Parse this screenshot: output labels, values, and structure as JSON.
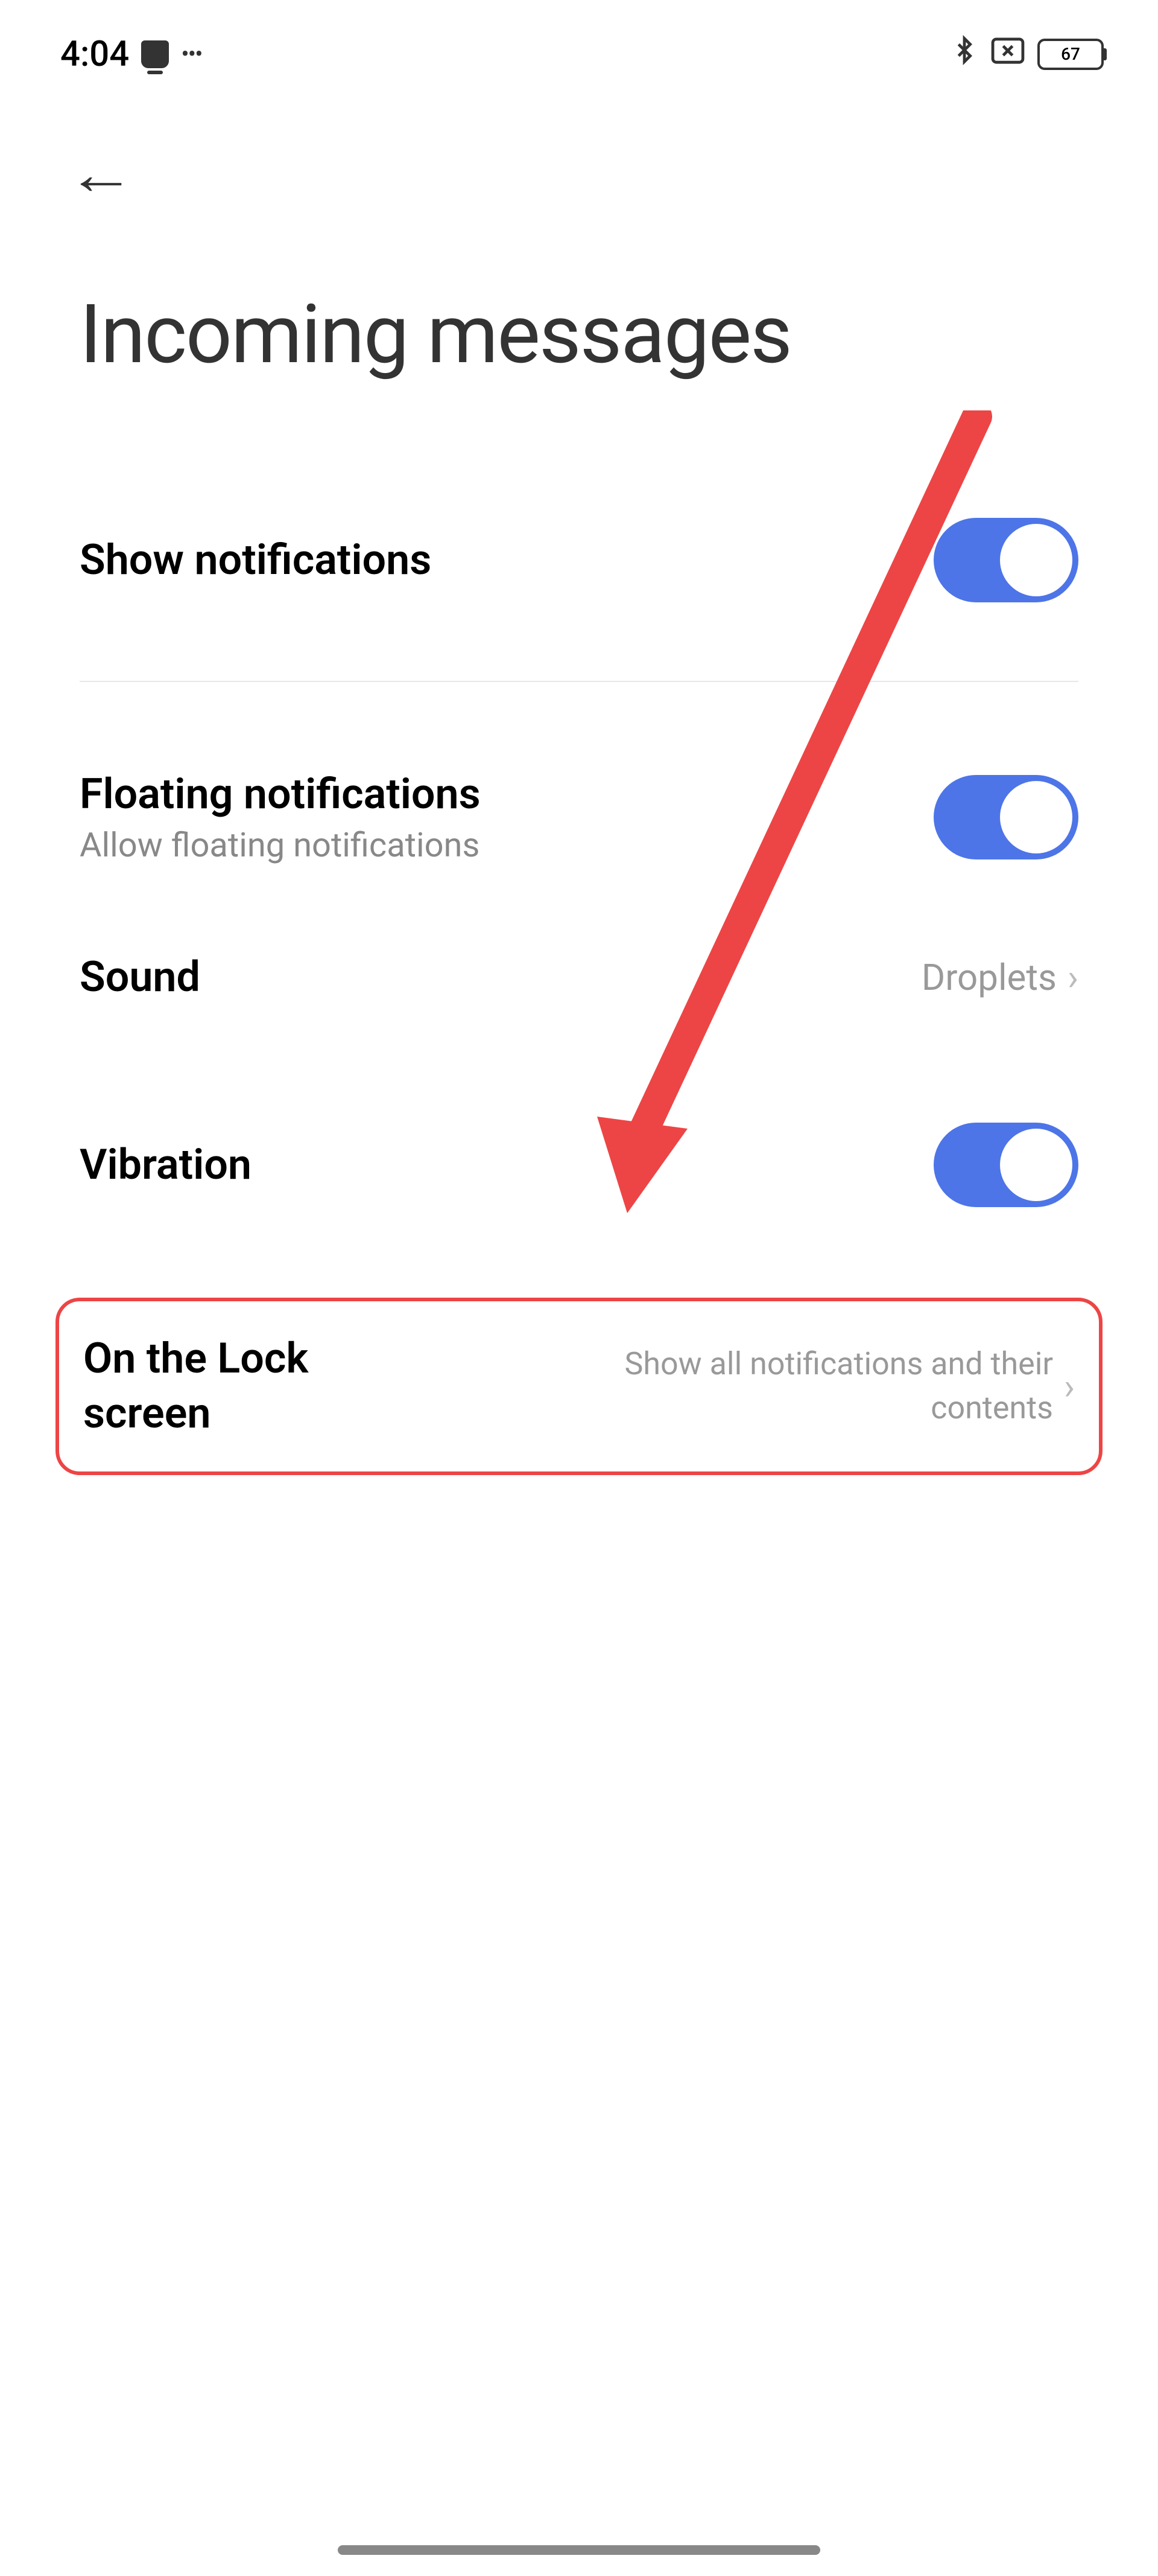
{
  "statusBar": {
    "time": "4:04",
    "batteryLevel": "67"
  },
  "page": {
    "title": "Incoming messages"
  },
  "settings": {
    "showNotifications": {
      "label": "Show notifications",
      "enabled": true
    },
    "floatingNotifications": {
      "label": "Floating notifications",
      "subtitle": "Allow floating notifications",
      "enabled": true
    },
    "sound": {
      "label": "Sound",
      "value": "Droplets"
    },
    "vibration": {
      "label": "Vibration",
      "enabled": true
    },
    "lockScreen": {
      "label": "On the Lock screen",
      "value": "Show all notifications and their contents"
    }
  }
}
